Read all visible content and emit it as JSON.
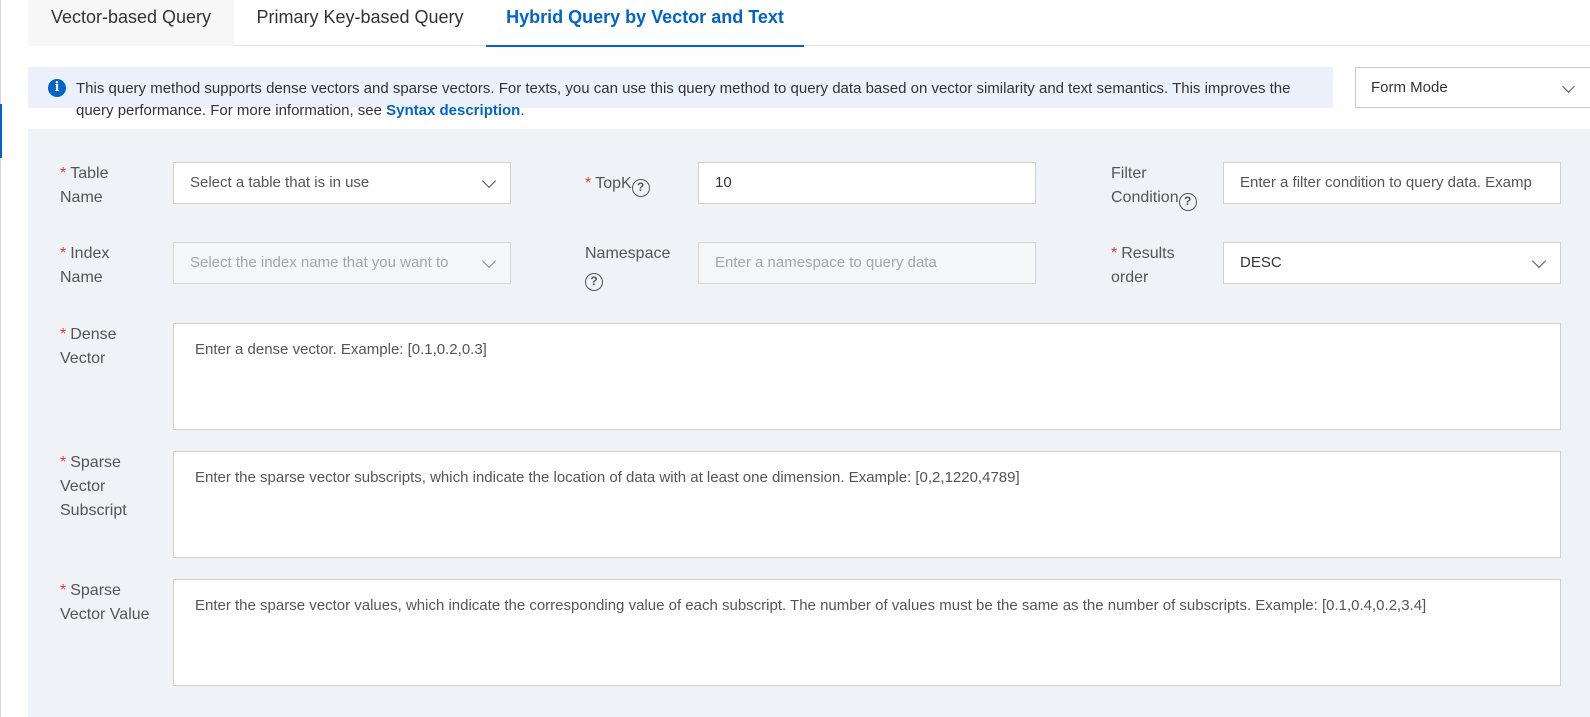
{
  "tabs": [
    {
      "label": "Vector-based Query"
    },
    {
      "label": "Primary Key-based Query"
    },
    {
      "label": "Hybrid Query by Vector and Text"
    }
  ],
  "notice": {
    "icon": "info-icon",
    "text": "This query method supports dense vectors and sparse vectors. For texts, you can use this query method to query data based on vector similarity and text semantics. This improves the query performance. For more information, see ",
    "link_label": "Syntax description",
    "suffix": "."
  },
  "mode_select": {
    "value": "Form Mode"
  },
  "form": {
    "table_name": {
      "label_line1": "Table",
      "label_line2": "Name",
      "placeholder": "Select a table that is in use"
    },
    "topk": {
      "label": "TopK",
      "value": "10"
    },
    "filter": {
      "label_line1": "Filter",
      "label_line2": "Condition",
      "placeholder": "Enter a filter condition to query data. Examp"
    },
    "index_name": {
      "label_line1": "Index",
      "label_line2": "Name",
      "placeholder": "Select the index name that you want to"
    },
    "namespace": {
      "label": "Namespace",
      "placeholder": "Enter a namespace to query data"
    },
    "results_order": {
      "label_line1": "Results",
      "label_line2": "order",
      "value": "DESC"
    },
    "dense_vector": {
      "label_line1": "Dense",
      "label_line2": "Vector",
      "placeholder": "Enter a dense vector. Example: [0.1,0.2,0.3]"
    },
    "sparse_subscript": {
      "label_line1": "Sparse",
      "label_line2": "Vector",
      "label_line3": "Subscript",
      "placeholder": "Enter the sparse vector subscripts, which indicate the location of data with at least one dimension. Example: [0,2,1220,4789]"
    },
    "sparse_value": {
      "label_line1": "Sparse",
      "label_line2": "Vector Value",
      "placeholder": "Enter the sparse vector values, which indicate the corresponding value of each subscript. The number of values must be the same as the number of subscripts. Example: [0.1,0.4,0.2,3.4]"
    }
  },
  "required_mark": "*",
  "help_glyph": "?",
  "colors": {
    "accent": "#0064c8",
    "required": "#e23c39",
    "panel_bg": "#eff2f6",
    "notice_bg": "#eaf1fa"
  }
}
